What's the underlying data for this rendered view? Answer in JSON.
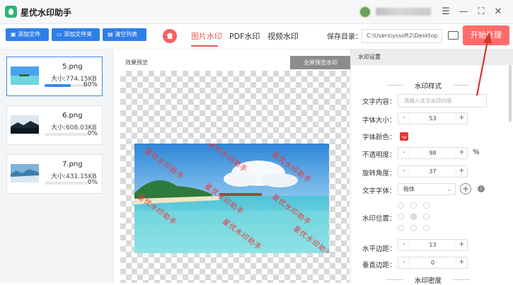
{
  "app": {
    "title": "星优水印助手"
  },
  "window": {
    "menu_icon": "menu-icon",
    "min_icon": "minimize-icon",
    "max_icon": "maximize-icon",
    "close_icon": "close-icon"
  },
  "toolbar": {
    "add_file": "添加文件",
    "add_folder": "添加文件夹",
    "clear_list": "清空列表",
    "tabs": [
      "图片水印",
      "PDF水印",
      "视频水印"
    ],
    "active_tab": "图片水印",
    "save_dir_label": "保存目录：",
    "save_dir_value": "C:\\Users\\yssoft2\\Desktop",
    "start_button": "开始处理"
  },
  "files": [
    {
      "name": "5.png",
      "size": "大小:774.15KB",
      "progress": 60,
      "progress_text": "60%",
      "selected": true
    },
    {
      "name": "6.png",
      "size": "大小:608.03KB",
      "progress": 0,
      "progress_text": "0%",
      "selected": false
    },
    {
      "name": "7.png",
      "size": "大小:431.15KB",
      "progress": 0,
      "progress_text": "0%",
      "selected": false
    }
  ],
  "preview": {
    "label": "效果预览",
    "fullscreen_button": "全屏预览水印",
    "watermark_text": "星优水印助手"
  },
  "settings": {
    "header": "水印设置",
    "section_style": "水印样式",
    "section_density": "水印密度",
    "text_content_label": "文字内容：",
    "text_content_placeholder": "请输入文字水印内容",
    "font_size_label": "字体大小：",
    "font_size_value": "53",
    "font_color_label": "字体颜色：",
    "font_color": "#e53935",
    "opacity_label": "不透明度：",
    "opacity_value": "98",
    "opacity_unit": "%",
    "rotation_label": "旋转角度：",
    "rotation_value": "37",
    "font_family_label": "文字字体：",
    "font_family_value": "楷体",
    "position_label": "水印位置：",
    "h_margin_label": "水平边距：",
    "h_margin_value": "13",
    "v_margin_label": "垂直边距：",
    "v_margin_value": "0",
    "minus": "-",
    "plus": "+"
  }
}
